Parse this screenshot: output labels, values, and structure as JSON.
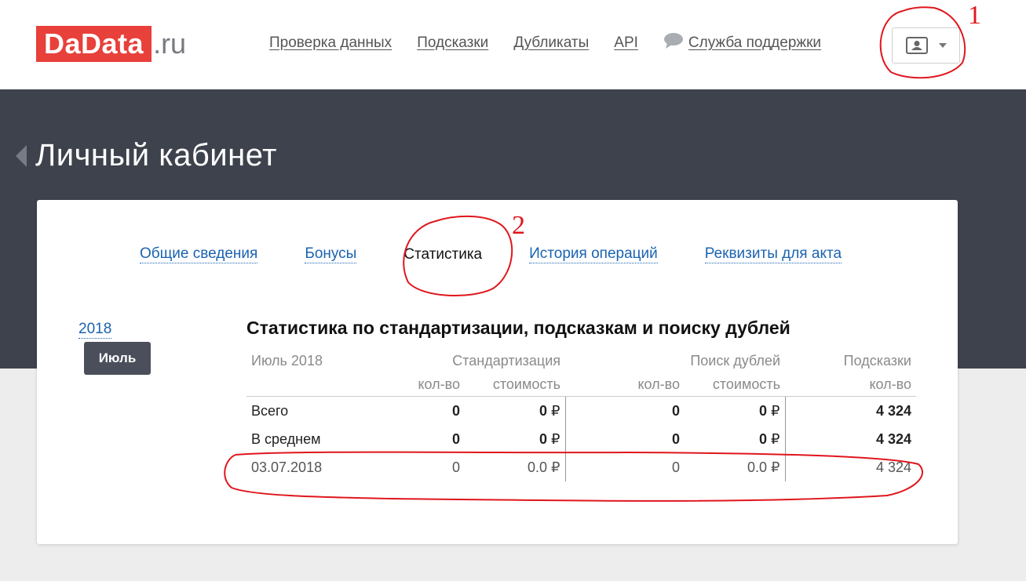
{
  "header": {
    "logo_main": "DaData",
    "logo_suffix": ".ru",
    "nav": [
      {
        "label": "Проверка данных"
      },
      {
        "label": "Подсказки"
      },
      {
        "label": "Дубликаты"
      },
      {
        "label": "API"
      }
    ],
    "support_label": "Служба поддержки",
    "user_menu_icon": "user-icon"
  },
  "page": {
    "title": "Личный кабинет"
  },
  "tabs": [
    {
      "label": "Общие сведения",
      "active": false
    },
    {
      "label": "Бонусы",
      "active": false
    },
    {
      "label": "Статистика",
      "active": true
    },
    {
      "label": "История операций",
      "active": false
    },
    {
      "label": "Реквизиты для акта",
      "active": false
    }
  ],
  "sidebar": {
    "year": "2018",
    "month": "Июль"
  },
  "stats": {
    "title": "Статистика по стандартизации, подсказкам и поиску дублей",
    "period": "Июль 2018",
    "groups": {
      "standardization": "Стандартизация",
      "duplicates": "Поиск дублей",
      "suggestions": "Подсказки"
    },
    "subheaders": {
      "count": "кол-во",
      "cost": "стоимость"
    },
    "currency": "₽",
    "rows": [
      {
        "label": "Всего",
        "std_count": "0",
        "std_cost": "0",
        "dup_count": "0",
        "dup_cost": "0",
        "sugg_count": "4 324",
        "bold": true
      },
      {
        "label": "В среднем",
        "std_count": "0",
        "std_cost": "0",
        "dup_count": "0",
        "dup_cost": "0",
        "sugg_count": "4 324",
        "bold": true
      },
      {
        "label": "03.07.2018",
        "std_count": "0",
        "std_cost": "0.0",
        "dup_count": "0",
        "dup_cost": "0.0",
        "sugg_count": "4 324",
        "bold": false
      }
    ]
  },
  "annotations": {
    "marker_1": "1",
    "marker_2": "2",
    "color": "#e0161c"
  }
}
